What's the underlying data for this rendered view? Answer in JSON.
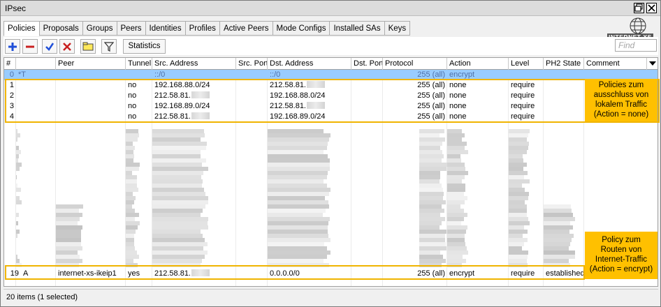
{
  "window": {
    "title": "IPsec"
  },
  "tabs": [
    {
      "label": "Policies",
      "active": true
    },
    {
      "label": "Proposals"
    },
    {
      "label": "Groups"
    },
    {
      "label": "Peers"
    },
    {
      "label": "Identities"
    },
    {
      "label": "Profiles"
    },
    {
      "label": "Active Peers"
    },
    {
      "label": "Mode Configs"
    },
    {
      "label": "Installed SAs"
    },
    {
      "label": "Keys"
    }
  ],
  "logo": {
    "text": "INTERNET XS"
  },
  "toolbar": {
    "add_icon": "plus-icon",
    "remove_icon": "minus-icon",
    "enable_icon": "check-icon",
    "disable_icon": "cross-icon",
    "comment_icon": "note-icon",
    "filter_icon": "filter-icon",
    "statistics_label": "Statistics"
  },
  "search": {
    "placeholder": "Find"
  },
  "columns": [
    "#",
    "",
    "Peer",
    "Tunnel",
    "Src. Address",
    "Src. Port",
    "Dst. Address",
    "Dst. Port",
    "Protocol",
    "Action",
    "Level",
    "PH2 State",
    "Comment"
  ],
  "rows": [
    {
      "num": "0",
      "flags": "*T",
      "peer": "",
      "tunnel": "",
      "src": "::/0",
      "srcport": "",
      "dst": "::/0",
      "dstport": "",
      "protocol": "255 (all)",
      "action": "encrypt",
      "level": "",
      "ph2": "",
      "comment": "",
      "selected": true
    },
    {
      "num": "1",
      "flags": "",
      "peer": "",
      "tunnel": "no",
      "src": "192.168.88.0/24",
      "srcport": "",
      "dst": "212.58.81.",
      "dstport": "",
      "protocol": "255 (all)",
      "action": "none",
      "level": "require",
      "ph2": "",
      "comment": ""
    },
    {
      "num": "2",
      "flags": "",
      "peer": "",
      "tunnel": "no",
      "src": "212.58.81.",
      "srcport": "",
      "dst": "192.168.88.0/24",
      "dstport": "",
      "protocol": "255 (all)",
      "action": "none",
      "level": "require",
      "ph2": "",
      "comment": ""
    },
    {
      "num": "3",
      "flags": "",
      "peer": "",
      "tunnel": "no",
      "src": "192.168.89.0/24",
      "srcport": "",
      "dst": "212.58.81.",
      "dstport": "",
      "protocol": "255 (all)",
      "action": "none",
      "level": "require",
      "ph2": "",
      "comment": ""
    },
    {
      "num": "4",
      "flags": "",
      "peer": "",
      "tunnel": "no",
      "src": "212.58.81.",
      "srcport": "",
      "dst": "192.168.89.0/24",
      "dstport": "",
      "protocol": "255 (all)",
      "action": "none",
      "level": "require",
      "ph2": "",
      "comment": ""
    },
    {
      "num": "19",
      "flags": "A",
      "peer": "internet-xs-ikeip1",
      "tunnel": "yes",
      "src": "212.58.81.",
      "srcport": "",
      "dst": "0.0.0.0/0",
      "dstport": "",
      "protocol": "255 (all)",
      "action": "encrypt",
      "level": "require",
      "ph2": "established",
      "comment": ""
    }
  ],
  "annotations": {
    "local_traffic": [
      "Policies zum",
      "ausschluss von",
      "lokalem Traffic",
      "(Action = none)"
    ],
    "internet_traffic": [
      "Policy zum",
      "Routen von",
      "Internet-Traffic",
      "(Action = encrypt)"
    ]
  },
  "status": {
    "text": "20 items (1 selected)"
  },
  "colors": {
    "selection": "#99ccff",
    "highlight": "#ffc000",
    "add": "#1f4fd8",
    "remove": "#c82020"
  }
}
